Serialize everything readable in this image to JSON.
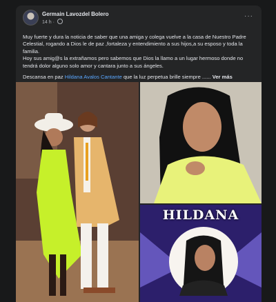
{
  "post": {
    "author": "Germain Lavozdel Bolero",
    "time": "14 h",
    "separator": "·",
    "more": "···",
    "p1": "Muy fuerte y dura la noticia de saber que una amiga y colega vuelve a la casa de Nuestro Padre Celestial, rogando a Dios le de paz ,fortaleza y entendimiento a sus hijos,a su esposo y toda la familia.",
    "p2": "Hoy sus amig@s la extrañamos pero sabemos que Dios la llamo a un lugar hermoso donde no tendrá dolor alguno solo amor y cantara junto a sus ángeles.",
    "p3_before": "Descansa en paz ",
    "p3_mention": "Hildana Avalos Cantante",
    "p3_after": " que la luz perpetua brille siempre ...... ",
    "see_more": "Ver más"
  },
  "photo3": {
    "title": "HILDANA"
  },
  "colors": {
    "background": "#18191a",
    "card": "#242526",
    "link": "#5aa7ff",
    "neon_dress": "#c6f02a"
  }
}
